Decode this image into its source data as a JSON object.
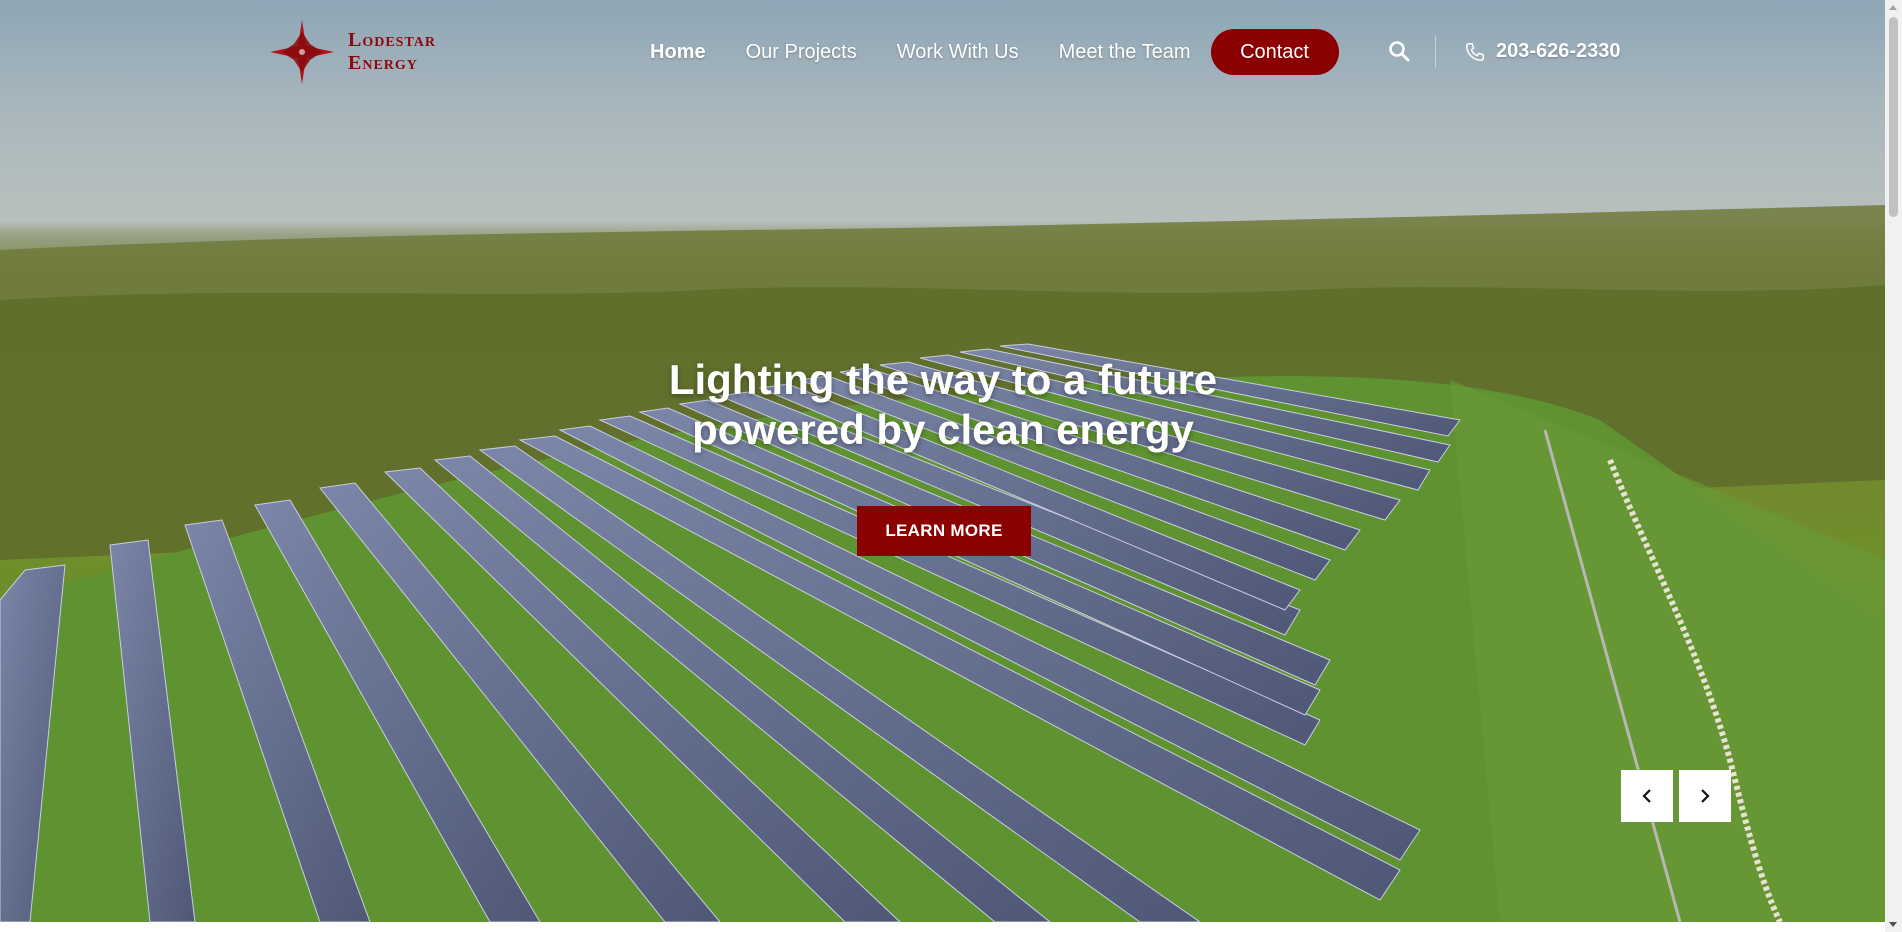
{
  "brand": {
    "name_line1": "Lodestar",
    "name_line2": "Energy",
    "logo_icon": "compass-star-icon",
    "color": "#8b0a0e"
  },
  "nav": {
    "items": [
      {
        "label": "Home",
        "active": true
      },
      {
        "label": "Our Projects",
        "active": false
      },
      {
        "label": "Work With Us",
        "active": false
      },
      {
        "label": "Meet the Team",
        "active": false
      }
    ],
    "contact_label": "Contact",
    "phone": "203-626-2330"
  },
  "hero": {
    "headline_line1": "Lighting the way to a future",
    "headline_line2": "powered by clean energy",
    "cta_label": "LEARN MORE",
    "accent": "#8b0000"
  },
  "icons": {
    "search": "search-icon",
    "phone": "phone-icon",
    "prev": "chevron-left-icon",
    "next": "chevron-right-icon"
  }
}
